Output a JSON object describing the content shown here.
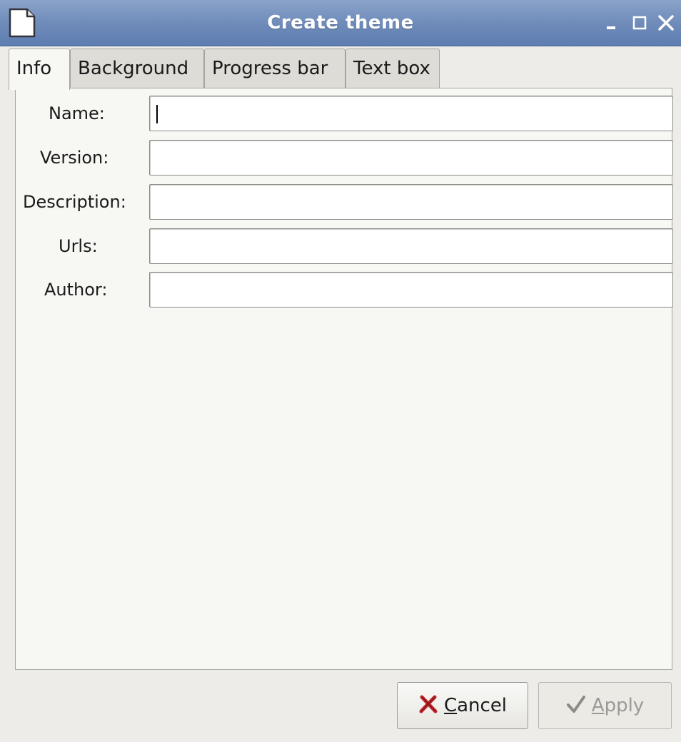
{
  "window": {
    "title": "Create theme",
    "icon": "document-icon",
    "controls": {
      "minimize": "minimize-icon",
      "maximize": "maximize-icon",
      "close": "close-icon"
    }
  },
  "tabs": [
    {
      "label": "Info",
      "active": true
    },
    {
      "label": "Background",
      "active": false
    },
    {
      "label": "Progress bar",
      "active": false
    },
    {
      "label": "Text box",
      "active": false
    }
  ],
  "form": {
    "fields": [
      {
        "label": "Name:",
        "value": "",
        "focused": true
      },
      {
        "label": "Version:",
        "value": ""
      },
      {
        "label": "Description:",
        "value": ""
      },
      {
        "label": "Urls:",
        "value": ""
      },
      {
        "label": "Author:",
        "value": ""
      }
    ]
  },
  "buttons": {
    "cancel": {
      "mnemonic": "C",
      "rest": "ancel",
      "icon": "cancel-x-icon",
      "enabled": true
    },
    "apply": {
      "mnemonic": "A",
      "rest": "pply",
      "icon": "checkmark-icon",
      "enabled": false
    }
  },
  "colors": {
    "titlebar": "#6f8cba",
    "cancel_icon": "#c0262a",
    "disabled_text": "#9b9a96"
  }
}
